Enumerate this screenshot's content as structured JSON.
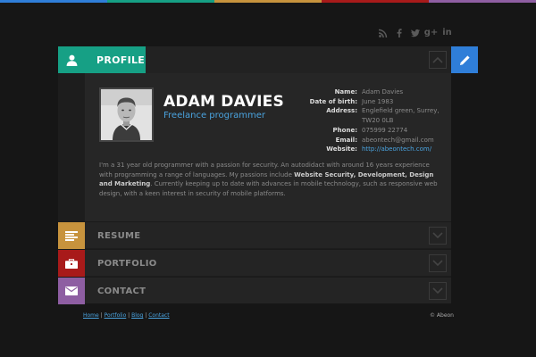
{
  "top_bar_colors": [
    "#2f7ed8",
    "#16a085",
    "#c7933d",
    "#a81a1a",
    "#8e5ea2"
  ],
  "social": {
    "icons": [
      "rss-icon",
      "facebook-icon",
      "twitter-icon",
      "google-plus-icon",
      "linkedin-icon"
    ],
    "gplus_text": "g+",
    "linkedin_text": "in"
  },
  "profile": {
    "tab_label": "PROFILE",
    "tab_color": "#16a085",
    "name": "ADAM DAVIES",
    "title": "Freelance programmer",
    "info": [
      {
        "key": "Name:",
        "value": "Adam Davies"
      },
      {
        "key": "Date of birth:",
        "value": "June 1983"
      },
      {
        "key": "Address:",
        "value": "Englefield green, Surrey, TW20 0LB"
      },
      {
        "key": "Phone:",
        "value": "075999 22774"
      },
      {
        "key": "Email:",
        "value": "abeontech@gmail.com"
      },
      {
        "key": "Website:",
        "value": "http://abeontech.com/"
      }
    ],
    "bio": {
      "p1": "I'm a 31 year old programmer with a passion for security. An autodidact with around 16 years experience with programming a range of languages. My passions include ",
      "bold": "Website Security, Development, Design and Marketing",
      "p2": ". Currently keeping up to date with advances in mobile technology, such as responsive web design, with a keen interest in security of mobile platforms."
    }
  },
  "edit_button_color": "#2f7ed8",
  "sections": [
    {
      "label": "RESUME",
      "color": "#c7933d",
      "icon": "resume-lines-icon"
    },
    {
      "label": "PORTFOLIO",
      "color": "#a81a1a",
      "icon": "briefcase-icon"
    },
    {
      "label": "CONTACT",
      "color": "#8e5ea2",
      "icon": "envelope-icon"
    }
  ],
  "footer": {
    "links": [
      "Home",
      "Portfolio",
      "Blog",
      "Contact"
    ],
    "separator": " | ",
    "copyright": "© Abeon"
  }
}
